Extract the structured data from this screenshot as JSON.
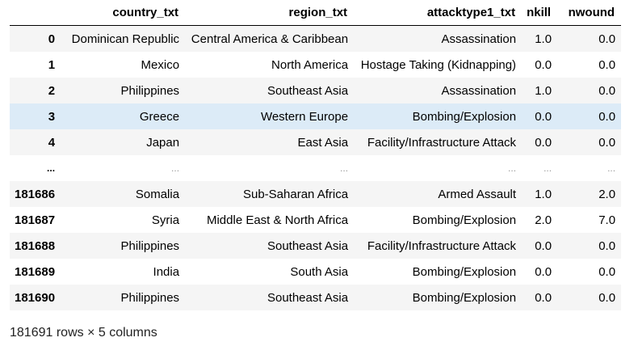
{
  "table": {
    "index_header": "",
    "columns": [
      "country_txt",
      "region_txt",
      "attacktype1_txt",
      "nkill",
      "nwound"
    ],
    "rows": [
      {
        "index": "0",
        "cells": [
          "Dominican Republic",
          "Central America & Caribbean",
          "Assassination",
          "1.0",
          "0.0"
        ]
      },
      {
        "index": "1",
        "cells": [
          "Mexico",
          "North America",
          "Hostage Taking (Kidnapping)",
          "0.0",
          "0.0"
        ]
      },
      {
        "index": "2",
        "cells": [
          "Philippines",
          "Southeast Asia",
          "Assassination",
          "1.0",
          "0.0"
        ]
      },
      {
        "index": "3",
        "cells": [
          "Greece",
          "Western Europe",
          "Bombing/Explosion",
          "0.0",
          "0.0"
        ]
      },
      {
        "index": "4",
        "cells": [
          "Japan",
          "East Asia",
          "Facility/Infrastructure Attack",
          "0.0",
          "0.0"
        ]
      },
      {
        "index": "...",
        "cells": [
          "...",
          "...",
          "...",
          "...",
          "..."
        ]
      },
      {
        "index": "181686",
        "cells": [
          "Somalia",
          "Sub-Saharan Africa",
          "Armed Assault",
          "1.0",
          "2.0"
        ]
      },
      {
        "index": "181687",
        "cells": [
          "Syria",
          "Middle East & North Africa",
          "Bombing/Explosion",
          "2.0",
          "7.0"
        ]
      },
      {
        "index": "181688",
        "cells": [
          "Philippines",
          "Southeast Asia",
          "Facility/Infrastructure Attack",
          "0.0",
          "0.0"
        ]
      },
      {
        "index": "181689",
        "cells": [
          "India",
          "South Asia",
          "Bombing/Explosion",
          "0.0",
          "0.0"
        ]
      },
      {
        "index": "181690",
        "cells": [
          "Philippines",
          "Southeast Asia",
          "Bombing/Explosion",
          "0.0",
          "0.0"
        ]
      }
    ]
  },
  "footer": {
    "shape": "181691 rows × 5 columns"
  },
  "colors": {
    "striped_row": "#f5f5f5",
    "hover_row": "#dcebf7",
    "header_rule": "#000000"
  }
}
